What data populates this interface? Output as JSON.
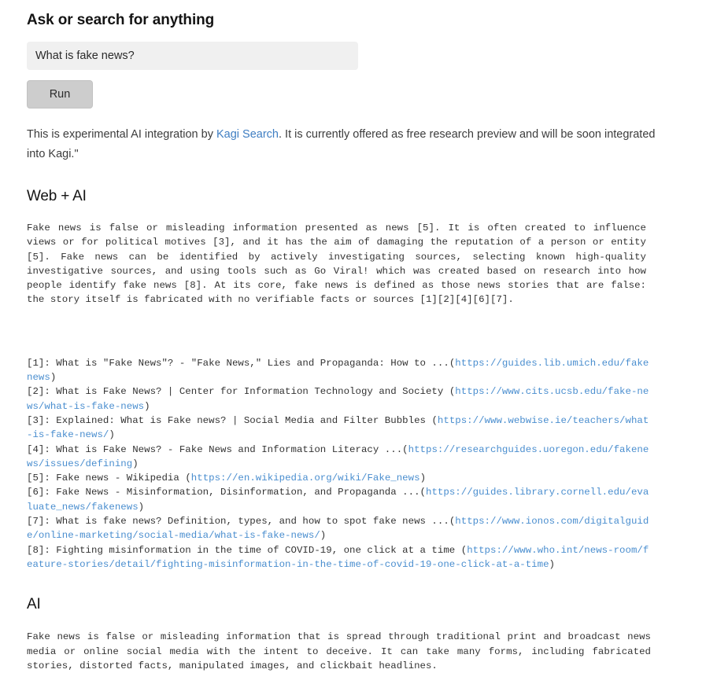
{
  "page": {
    "title": "Ask or search for anything"
  },
  "search": {
    "value": "What is fake news?",
    "placeholder": "Ask or search for anything",
    "run_label": "Run"
  },
  "intro": {
    "before_link": "This is experimental AI integration by ",
    "link_text": "Kagi Search",
    "after_link": ". It is currently offered as free research preview and will be soon integrated into Kagi.\""
  },
  "web_ai": {
    "heading": "Web + AI",
    "answer": "Fake news is false or misleading information presented as news [5]. It is often created to influence views or for political motives [3], and it has the aim of damaging the reputation of a person or entity [5]. Fake news can be identified by actively investigating sources, selecting known high-quality investigative sources, and using tools such as Go Viral! which was created based on research into how people identify fake news [8]. At its core, fake news is defined as those news stories that are false: the story itself is fabricated with no verifiable facts or sources [1][2][4][6][7]."
  },
  "references": [
    {
      "label": "[1]: What is \"Fake News\"? - \"Fake News,\" Lies and Propaganda: How to ...",
      "url_open": "(",
      "url": "https://guides.lib.umich.edu/fakenews",
      "url_close": ")"
    },
    {
      "label": "[2]: What is Fake News? | Center for Information Technology and Society ",
      "url_open": "(",
      "url": "https://www.cits.ucsb.edu/fake-news/what-is-fake-news",
      "url_close": ")"
    },
    {
      "label": "[3]: Explained: What is Fake news? | Social Media and Filter Bubbles ",
      "url_open": "(",
      "url": "https://www.webwise.ie/teachers/what-is-fake-news/",
      "url_close": ")"
    },
    {
      "label": "[4]: What is Fake News? - Fake News and Information Literacy ...",
      "url_open": "(",
      "url": "https://researchguides.uoregon.edu/fakenews/issues/defining",
      "url_close": ")"
    },
    {
      "label": "[5]: Fake news - Wikipedia ",
      "url_open": "(",
      "url": "https://en.wikipedia.org/wiki/Fake_news",
      "url_close": ")"
    },
    {
      "label": "[6]: Fake News - Misinformation, Disinformation, and Propaganda ...",
      "url_open": "(",
      "url": "https://guides.library.cornell.edu/evaluate_news/fakenews",
      "url_close": ")"
    },
    {
      "label": "[7]: What is fake news? Definition, types, and how to spot fake news ...",
      "url_open": "(",
      "url": "https://www.ionos.com/digitalguide/online-marketing/social-media/what-is-fake-news/",
      "url_close": ")"
    },
    {
      "label": "[8]: Fighting misinformation in the time of COVID-19, one click at a time ",
      "url_open": "(",
      "url": "https://www.who.int/news-room/feature-stories/detail/fighting-misinformation-in-the-time-of-covid-19-one-click-at-a-time",
      "url_close": ")"
    }
  ],
  "ai": {
    "heading": "AI",
    "answer": "Fake news is false or misleading information that is spread through traditional print and broadcast news media or online social media with the intent to deceive. It can take many forms, including fabricated stories, distorted facts, manipulated images, and clickbait headlines."
  },
  "colors": {
    "link_blue": "#3f7ec2",
    "ref_link_blue": "#4a8ecf",
    "input_bg": "#f0f0f0",
    "button_bg": "#cdcdcd"
  }
}
